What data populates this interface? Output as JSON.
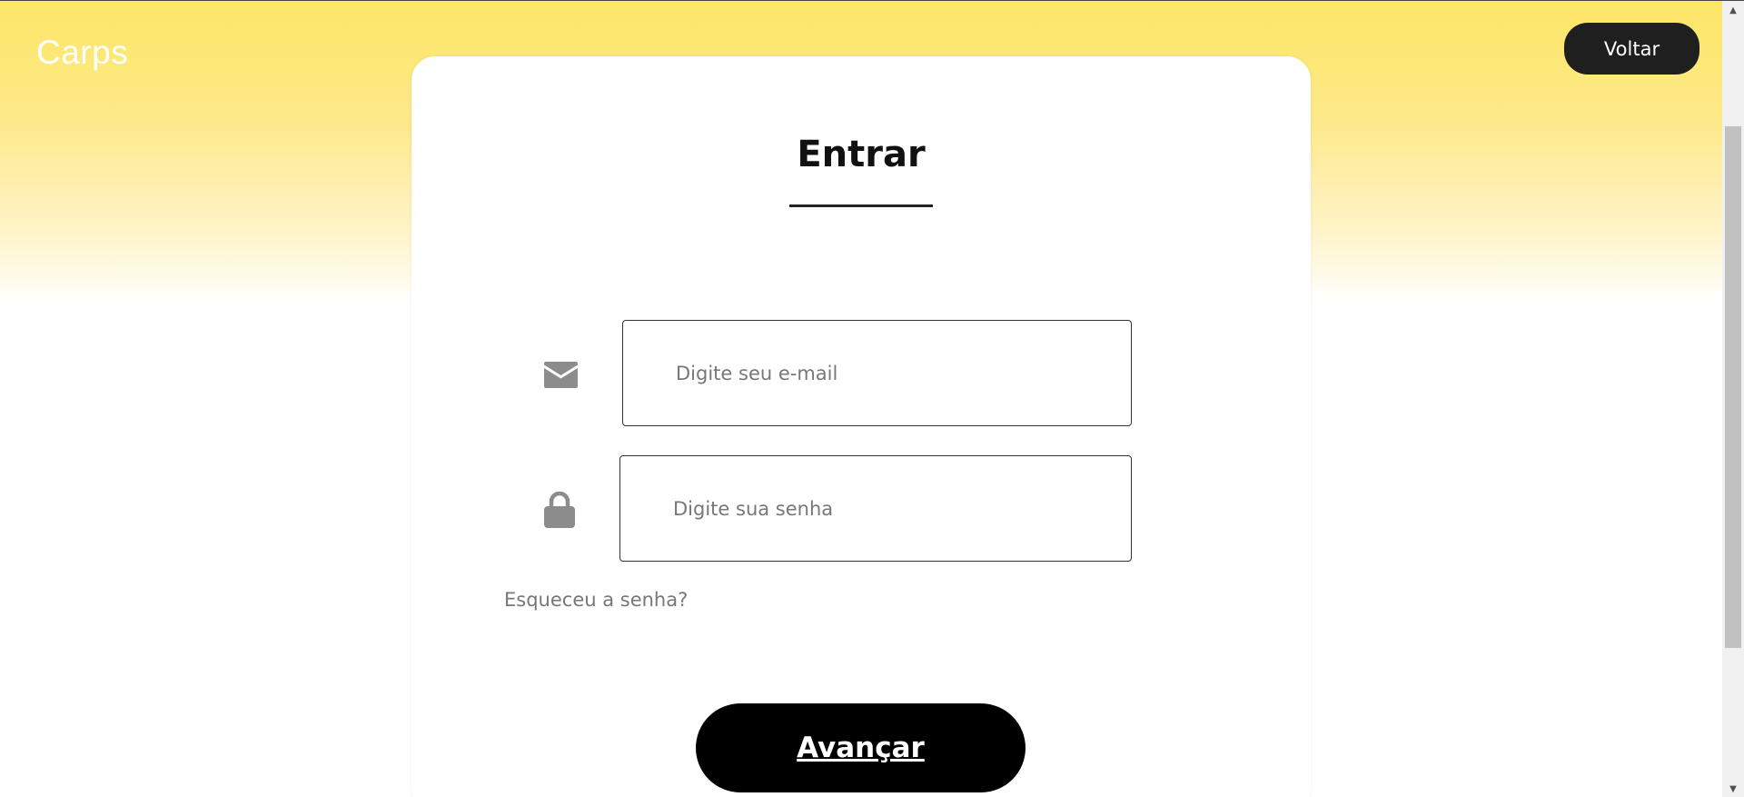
{
  "header": {
    "brand": "Carps",
    "back_label": "Voltar"
  },
  "login": {
    "title": "Entrar",
    "email": {
      "value": "",
      "placeholder": "Digite seu e-mail",
      "icon": "envelope-icon"
    },
    "password": {
      "value": "",
      "placeholder": "Digite sua senha",
      "icon": "lock-icon"
    },
    "forgot_label": "Esqueceu a senha?",
    "submit_label": "Avançar"
  },
  "colors": {
    "accent_yellow": "#fde666",
    "button_dark": "#1f1f1f",
    "submit_black": "#000000",
    "icon_gray": "#8c8c8c"
  }
}
